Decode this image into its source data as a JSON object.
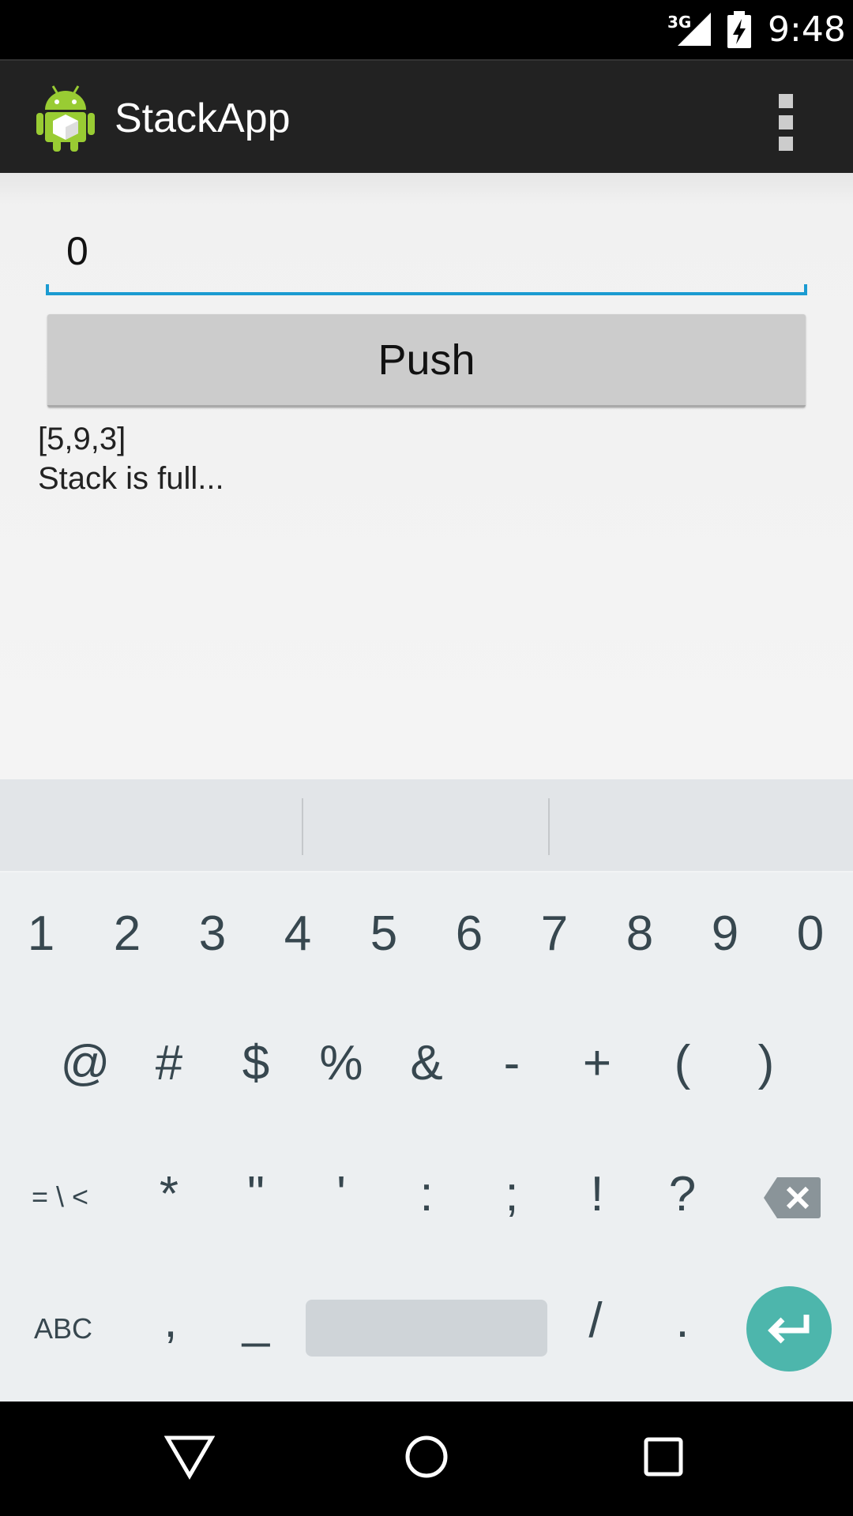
{
  "status_bar": {
    "network": "3G",
    "time": "9:48"
  },
  "action_bar": {
    "title": "StackApp",
    "app_icon": "android-icon",
    "overflow_icon": "more-vert-icon"
  },
  "main": {
    "input_value": "0",
    "push_label": "Push",
    "stack_contents": "[5,9,3]",
    "status_message": "Stack is full..."
  },
  "keyboard": {
    "row1": [
      "1",
      "2",
      "3",
      "4",
      "5",
      "6",
      "7",
      "8",
      "9",
      "0"
    ],
    "row2": [
      "@",
      "#",
      "$",
      "%",
      "&",
      "-",
      "+",
      "(",
      ")"
    ],
    "row3": [
      "= \\ <",
      "*",
      "\"",
      "'",
      ":",
      ";",
      "!",
      "?"
    ],
    "row4": [
      "ABC",
      ",",
      "_",
      "/",
      "."
    ],
    "accent": "#4db6ac"
  },
  "nav_bar": {
    "back_icon": "back-triangle-icon",
    "home_icon": "home-circle-icon",
    "recents_icon": "recents-square-icon"
  }
}
